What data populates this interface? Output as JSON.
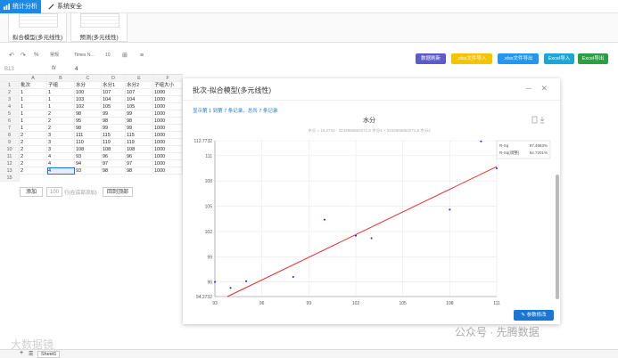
{
  "nav": {
    "tabs": [
      {
        "label": "统计分析",
        "icon": "chart-icon",
        "active": true
      },
      {
        "label": "系统安全",
        "icon": "wrench-icon",
        "active": false
      }
    ]
  },
  "ribbon": {
    "buttons": [
      {
        "label": "拟合模型(多元线性)"
      },
      {
        "label": "预测(多元线性)"
      }
    ]
  },
  "toolbar": {
    "undo_icon": "undo-icon",
    "redo_icon": "redo-icon",
    "percent": "%",
    "font_dropdown": "Times N...",
    "size_dropdown": "10",
    "format_dropdown": "常规"
  },
  "actions": [
    {
      "label": "数据刷新",
      "color": "#5c5cc8"
    },
    {
      "label": ".xlsx文件导入",
      "color": "#f5c400"
    },
    {
      "label": ".xlsx文件导出",
      "color": "#2196f3"
    },
    {
      "label": "Excel导入",
      "color": "#1ba7d6"
    },
    {
      "label": "Excel导出",
      "color": "#2e9e44"
    }
  ],
  "formula_bar": {
    "cell_ref": "B13",
    "fx": "fx",
    "value": "4"
  },
  "sheet": {
    "col_letters": [
      "A",
      "B",
      "C",
      "D",
      "E",
      "F"
    ],
    "headers": [
      "批次",
      "子组",
      "水分",
      "水分1",
      "水分2",
      "子组大小"
    ],
    "rows": [
      [
        "1",
        "1",
        "100",
        "107",
        "107",
        "1000"
      ],
      [
        "1",
        "1",
        "103",
        "104",
        "104",
        "1000"
      ],
      [
        "1",
        "1",
        "102",
        "105",
        "105",
        "1000"
      ],
      [
        "1",
        "2",
        "98",
        "99",
        "99",
        "1000"
      ],
      [
        "1",
        "2",
        "95",
        "98",
        "98",
        "1000"
      ],
      [
        "1",
        "2",
        "98",
        "99",
        "99",
        "1000"
      ],
      [
        "2",
        "3",
        "111",
        "115",
        "115",
        "1000"
      ],
      [
        "2",
        "3",
        "110",
        "119",
        "119",
        "1000"
      ],
      [
        "2",
        "3",
        "108",
        "108",
        "108",
        "1000"
      ],
      [
        "2",
        "4",
        "93",
        "96",
        "96",
        "1000"
      ],
      [
        "2",
        "4",
        "94",
        "97",
        "97",
        "1000"
      ],
      [
        "2",
        "4",
        "93",
        "98",
        "98",
        "1000"
      ]
    ]
  },
  "bottom": {
    "add_label": "添加",
    "count_value": "100",
    "count_hint": "行(在底部添加)",
    "back_top": "回到顶部"
  },
  "modal": {
    "title": "批次-拟合模型(多元线性)",
    "minimize": "─",
    "close": "✕",
    "info": "显示第 1 到第 7 条记录，总共 7 条记录",
    "param_button": "参数修改"
  },
  "chart_data": {
    "type": "scatter",
    "title": "水分",
    "subtitle": "水分 = 16.2732 - 3232965863271.8 水分1 + 3232965863271.8 水分2",
    "x": [
      93,
      94,
      95,
      98,
      100,
      102,
      103,
      108,
      110,
      111
    ],
    "y": [
      96.0,
      95.3,
      96.1,
      96.6,
      103.4,
      101.5,
      101.2,
      104.6,
      112.7,
      109.5
    ],
    "fit_line": {
      "x": [
        93.8,
        111
      ],
      "y": [
        94.2732,
        109.7
      ]
    },
    "xlim": [
      93,
      111
    ],
    "ylim": [
      94.2732,
      112.7732
    ],
    "xticks": [
      "93",
      "96",
      "99",
      "102",
      "105",
      "108",
      "111"
    ],
    "yticks": [
      "94.2732",
      "96",
      "99",
      "102",
      "105",
      "108",
      "111",
      "112.7732"
    ],
    "legend": [
      {
        "label": "R-Sq",
        "value": "87.4983%"
      },
      {
        "label": "R-Sq(调整)",
        "value": "84.7201%"
      }
    ],
    "point_color": "#1a1aff",
    "line_color": "#e03030",
    "grid": true
  },
  "sheets": {
    "tab": "Sheet1",
    "add": "+"
  },
  "watermark": {
    "left": "大数据镜",
    "right": "公众号 · 先腾数据"
  }
}
